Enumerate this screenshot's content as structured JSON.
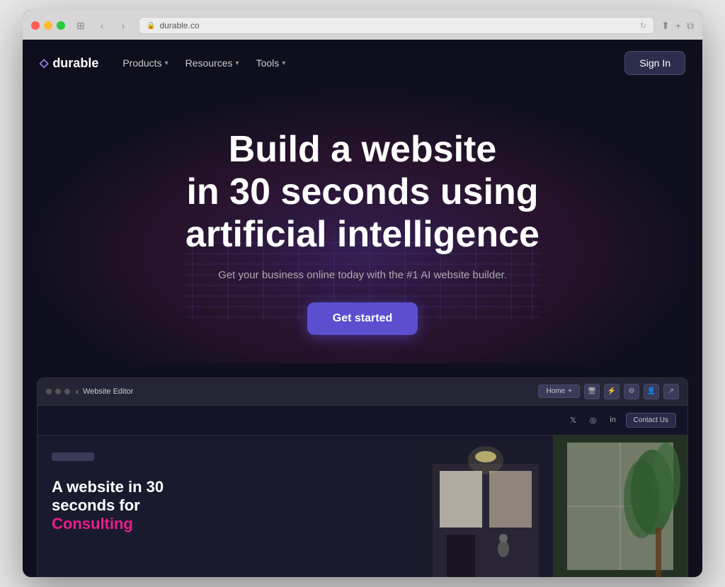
{
  "browser": {
    "url": "durable.co",
    "nav_back": "‹",
    "nav_forward": "›",
    "share_icon": "⬆",
    "add_tab_icon": "+",
    "windows_icon": "⧉"
  },
  "site": {
    "logo_text": "durable",
    "logo_icon": "◇",
    "nav": {
      "items": [
        {
          "label": "Products",
          "has_dropdown": true
        },
        {
          "label": "Resources",
          "has_dropdown": true
        },
        {
          "label": "Tools",
          "has_dropdown": true
        }
      ],
      "sign_in": "Sign In"
    },
    "hero": {
      "title_line1": "Build a website",
      "title_line2": "in 30 seconds using",
      "title_line3": "artificial intelligence",
      "subtitle": "Get your business online today with the #1 AI website builder.",
      "cta_button": "Get started"
    },
    "preview": {
      "chrome_title": "Website Editor",
      "tab_label": "Home",
      "tab_plus": "+",
      "social_icons": [
        "𝕏",
        "◎",
        "in"
      ],
      "contact_us": "Contact Us",
      "preview_hero_line1": "A website in 30",
      "preview_hero_line2": "seconds for",
      "preview_hero_highlight": "Consulting"
    }
  }
}
